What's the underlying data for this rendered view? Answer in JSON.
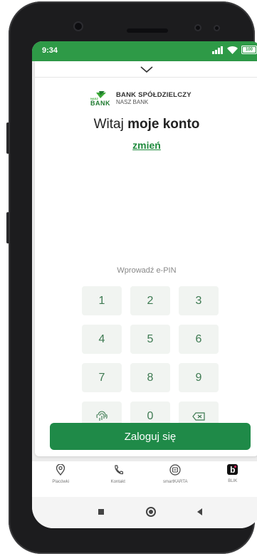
{
  "status_bar": {
    "time": "9:34",
    "battery": "100"
  },
  "bank": {
    "name_line1": "BANK SPÓŁDZIELCZY",
    "name_line2": "NASZ BANK",
    "logo_small": "NASZ",
    "logo_big": "BANK"
  },
  "login": {
    "greeting_prefix": "Witaj",
    "account_name": "moje konto",
    "change_link": "zmień",
    "epin_label": "Wprowadź e-PIN",
    "keys": [
      "1",
      "2",
      "3",
      "4",
      "5",
      "6",
      "7",
      "8",
      "9",
      "0"
    ],
    "submit_label": "Zaloguj się"
  },
  "bottom_nav": [
    {
      "label": "Placówki",
      "icon": "location-pin-icon"
    },
    {
      "label": "Kontakt",
      "icon": "phone-icon"
    },
    {
      "label": "smartKARTA",
      "icon": "smart-card-icon"
    },
    {
      "label": "BLIK",
      "icon": "blik-icon"
    }
  ],
  "colors": {
    "status_bar": "#2e9a47",
    "primary": "#1f8a48",
    "link": "#1f8a3d",
    "key_bg": "#f1f4f1"
  }
}
